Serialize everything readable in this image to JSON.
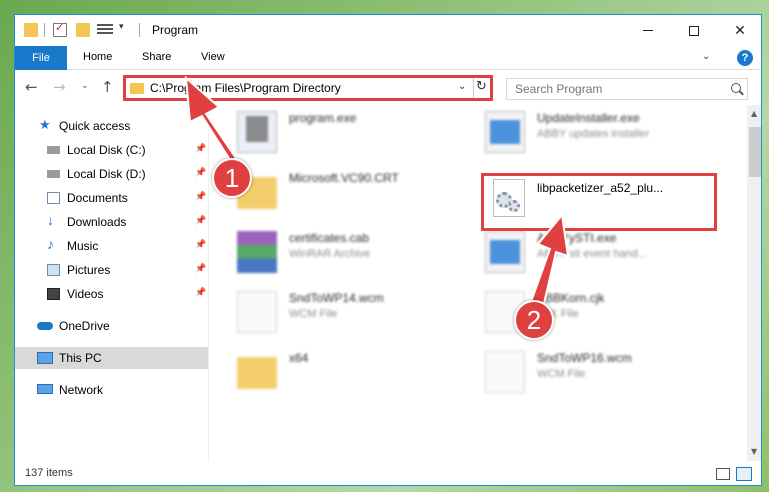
{
  "window": {
    "title": "Program",
    "controls": {
      "minimize": "",
      "maximize": "",
      "close": "✕"
    }
  },
  "ribbon": {
    "tabs": [
      "File",
      "Home",
      "Share",
      "View"
    ],
    "help": "?"
  },
  "address_bar": {
    "path": "C:\\Program Files\\Program Directory",
    "refresh": "↻"
  },
  "search": {
    "placeholder": "Search Program"
  },
  "nav": {
    "back": "←",
    "forward": "→",
    "recent": "⌄",
    "up": "↑"
  },
  "sidebar": {
    "items": [
      {
        "label": "Quick access",
        "icon": "star-icon"
      },
      {
        "label": "Local Disk (C:)",
        "icon": "drive-icon",
        "pinned": true
      },
      {
        "label": "Local Disk (D:)",
        "icon": "drive-icon",
        "pinned": true
      },
      {
        "label": "Documents",
        "icon": "documents-icon",
        "pinned": true
      },
      {
        "label": "Downloads",
        "icon": "downloads-icon",
        "pinned": true
      },
      {
        "label": "Music",
        "icon": "music-icon",
        "pinned": true
      },
      {
        "label": "Pictures",
        "icon": "pictures-icon",
        "pinned": true
      },
      {
        "label": "Videos",
        "icon": "videos-icon",
        "pinned": true
      },
      {
        "label": "OneDrive",
        "icon": "cloud-icon"
      },
      {
        "label": "This PC",
        "icon": "computer-icon",
        "selected": true
      },
      {
        "label": "Network",
        "icon": "network-icon"
      }
    ],
    "pin_glyph": "📌"
  },
  "files": [
    {
      "name": "program.exe",
      "desc": "",
      "icon": "application-icon"
    },
    {
      "name": "UpdateInstaller.exe",
      "desc": "ABBY updates installer",
      "icon": "application-icon"
    },
    {
      "name": "Microsoft.VC90.CRT",
      "desc": "",
      "icon": "folder-icon"
    },
    {
      "name": "libpacketizer_a52_plu...",
      "desc": "",
      "icon": "dll-gear-icon"
    },
    {
      "name": "certificates.cab",
      "desc": "WinRAR Archive",
      "icon": "winrar-icon"
    },
    {
      "name": "ABBYySTI.exe",
      "desc": "ABBY sti event hand...",
      "icon": "application-icon"
    },
    {
      "name": "SndToWP14.wcm",
      "desc": "WCM File",
      "icon": "document-icon"
    },
    {
      "name": "ABBKorn.cjk",
      "desc": "CJK File",
      "icon": "document-icon"
    },
    {
      "name": "x64",
      "desc": "",
      "icon": "folder-icon"
    },
    {
      "name": "SndToWP16.wcm",
      "desc": "WCM File",
      "icon": "document-icon"
    }
  ],
  "status": {
    "item_count": "137 items"
  },
  "annotations": {
    "step1": "1",
    "step2": "2",
    "color": "#e04040"
  }
}
